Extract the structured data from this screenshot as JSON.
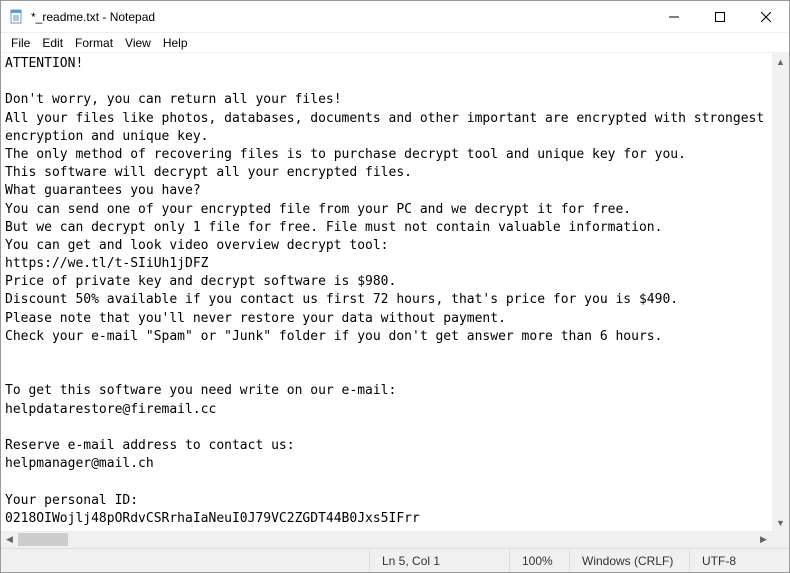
{
  "window": {
    "title": "*_readme.txt - Notepad"
  },
  "menu": {
    "file": "File",
    "edit": "Edit",
    "format": "Format",
    "view": "View",
    "help": "Help"
  },
  "content": "ATTENTION!\n\nDon't worry, you can return all your files!\nAll your files like photos, databases, documents and other important are encrypted with strongest encryption and unique key.\nThe only method of recovering files is to purchase decrypt tool and unique key for you.\nThis software will decrypt all your encrypted files.\nWhat guarantees you have?\nYou can send one of your encrypted file from your PC and we decrypt it for free.\nBut we can decrypt only 1 file for free. File must not contain valuable information.\nYou can get and look video overview decrypt tool:\nhttps://we.tl/t-SIiUh1jDFZ\nPrice of private key and decrypt software is $980.\nDiscount 50% available if you contact us first 72 hours, that's price for you is $490.\nPlease note that you'll never restore your data without payment.\nCheck your e-mail \"Spam\" or \"Junk\" folder if you don't get answer more than 6 hours.\n\n\nTo get this software you need write on our e-mail:\nhelpdatarestore@firemail.cc\n\nReserve e-mail address to contact us:\nhelpmanager@mail.ch\n\nYour personal ID:\n0218OIWojlj48pORdvCSRrhaIaNeuI0J79VC2ZGDT44B0Jxs5IFrr",
  "status": {
    "position": "Ln 5, Col 1",
    "zoom": "100%",
    "line_ending": "Windows (CRLF)",
    "encoding": "UTF-8"
  }
}
